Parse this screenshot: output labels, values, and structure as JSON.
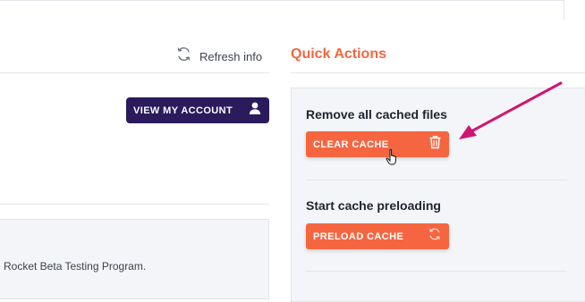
{
  "header": {
    "refresh_label": "Refresh info",
    "quick_actions_title": "Quick Actions"
  },
  "account": {
    "view_account_label": "VIEW MY ACCOUNT"
  },
  "quick_actions": {
    "remove_cache_title": "Remove all cached files",
    "clear_cache_label": "CLEAR CACHE",
    "preload_title": "Start cache preloading",
    "preload_label": "PRELOAD CACHE"
  },
  "content": {
    "beta_text": "Rocket Beta Testing Program."
  },
  "colors": {
    "accent": "#f56640",
    "primary_dark": "#2b1a5c",
    "annotation_arrow": "#d01672"
  },
  "icons": {
    "refresh": "refresh-icon",
    "user": "user-icon",
    "trash": "trash-icon",
    "preload": "sync-icon",
    "cursor": "hand-cursor-icon",
    "arrow": "annotation-arrow-icon"
  }
}
